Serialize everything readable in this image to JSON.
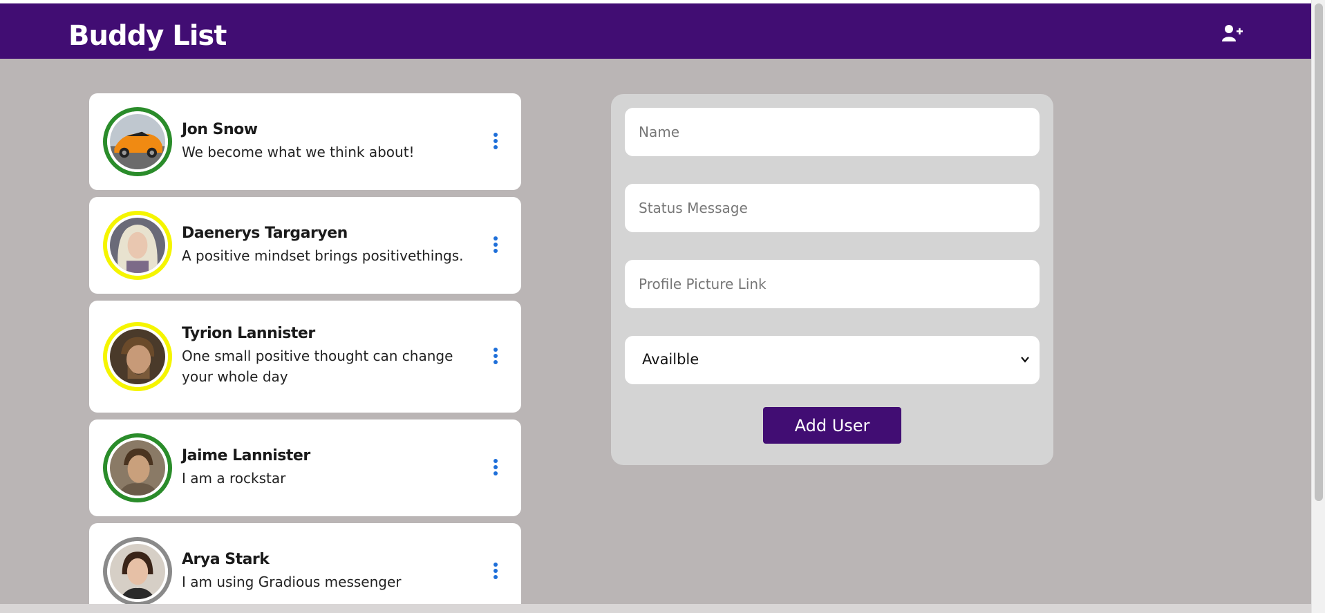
{
  "app": {
    "title": "Buddy List",
    "header_color": "#410d73",
    "add_user_icon": "user-plus-icon"
  },
  "buddies": [
    {
      "name": "Jon Snow",
      "status": "We become what we think about!",
      "availability": "available",
      "ring_color": "#2a8c2a",
      "avatar": "orange-sports-car"
    },
    {
      "name": "Daenerys Targaryen",
      "status": "A positive mindset brings positivethings.",
      "availability": "away",
      "ring_color": "#f5f500",
      "avatar": "platinum-haired-woman"
    },
    {
      "name": "Tyrion Lannister",
      "status": "One small positive thought can change your whole day",
      "availability": "away",
      "ring_color": "#f5f500",
      "avatar": "bearded-man"
    },
    {
      "name": "Jaime Lannister",
      "status": "I am a rockstar",
      "availability": "available",
      "ring_color": "#2a8c2a",
      "avatar": "knight-man"
    },
    {
      "name": "Arya Stark",
      "status": "I am using Gradious messenger",
      "availability": "offline",
      "ring_color": "#8a8a8a",
      "avatar": "dark-haired-girl"
    }
  ],
  "form": {
    "name_placeholder": "Name",
    "status_placeholder": "Status Message",
    "picture_placeholder": "Profile Picture Link",
    "availability_selected": "Availble",
    "submit_label": "Add User"
  }
}
